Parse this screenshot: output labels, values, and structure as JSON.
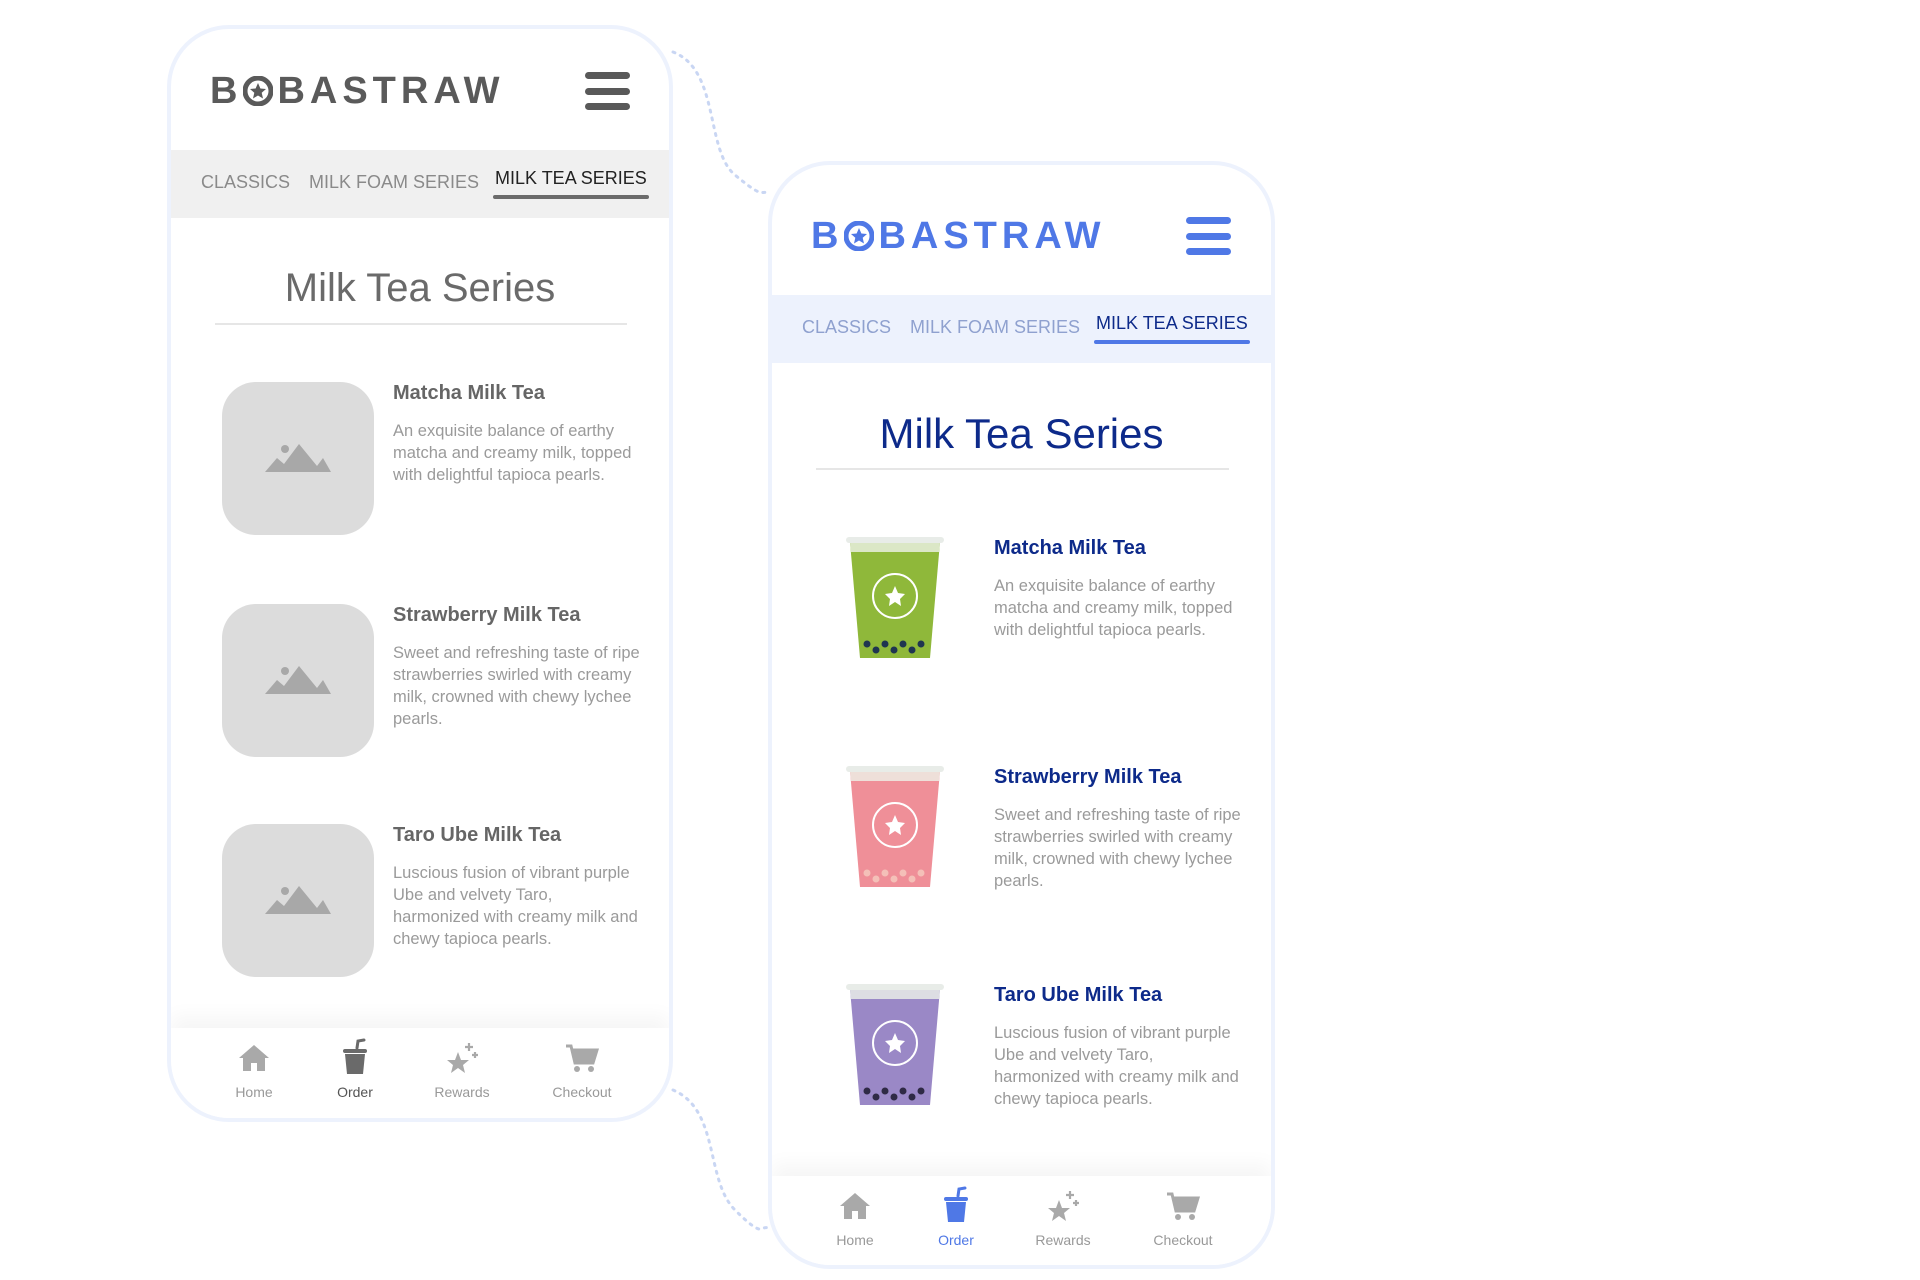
{
  "colors": {
    "accent": "#4f78e6",
    "navy": "#0d2a8a",
    "wire_gray": "#5a5a5a",
    "tabbar_blue": "#edf2fd",
    "tabbar_gray": "#f0f0f0"
  },
  "wireframe": {
    "logo": "BOBASTRAW",
    "tabs": [
      {
        "label": "CLASSICS"
      },
      {
        "label": "MILK FOAM SERIES"
      },
      {
        "label": "MILK TEA SERIES",
        "active": true
      }
    ],
    "title": "Milk Tea Series",
    "items": [
      {
        "name": "Matcha Milk Tea",
        "desc": "An exquisite balance of earthy matcha and creamy milk, topped with delightful tapioca pearls.",
        "icon": "image-placeholder-icon"
      },
      {
        "name": "Strawberry Milk Tea",
        "desc": "Sweet and refreshing taste of ripe strawberries swirled with creamy milk, crowned with chewy lychee pearls.",
        "icon": "image-placeholder-icon"
      },
      {
        "name": "Taro Ube Milk Tea",
        "desc": "Luscious fusion of vibrant purple Ube and velvety Taro, harmonized with creamy milk and chewy tapioca pearls.",
        "icon": "image-placeholder-icon"
      }
    ],
    "nav": [
      {
        "label": "Home",
        "icon": "home-icon"
      },
      {
        "label": "Order",
        "icon": "cup-icon",
        "active": true
      },
      {
        "label": "Rewards",
        "icon": "stars-icon"
      },
      {
        "label": "Checkout",
        "icon": "cart-icon"
      }
    ]
  },
  "final": {
    "logo": "BOBASTRAW",
    "tabs": [
      {
        "label": "CLASSICS"
      },
      {
        "label": "MILK FOAM SERIES"
      },
      {
        "label": "MILK TEA SERIES",
        "active": true
      }
    ],
    "title": "Milk Tea Series",
    "items": [
      {
        "name": "Matcha Milk Tea",
        "desc": "An exquisite balance of earthy matcha and creamy milk, topped with delightful tapioca pearls.",
        "drink_color": "#8fb83a",
        "pearl_color": "#1f3550"
      },
      {
        "name": "Strawberry Milk Tea",
        "desc": "Sweet and refreshing taste of ripe strawberries swirled with creamy milk, crowned with chewy lychee pearls.",
        "drink_color": "#ef8f98",
        "pearl_color": "#f4c0b8"
      },
      {
        "name": "Taro Ube Milk Tea",
        "desc": "Luscious fusion of vibrant purple Ube and velvety Taro, harmonized with creamy milk and chewy tapioca pearls.",
        "drink_color": "#9a88c6",
        "pearl_color": "#2f2a45"
      }
    ],
    "nav": [
      {
        "label": "Home",
        "icon": "home-icon"
      },
      {
        "label": "Order",
        "icon": "cup-icon",
        "active": true
      },
      {
        "label": "Rewards",
        "icon": "stars-icon"
      },
      {
        "label": "Checkout",
        "icon": "cart-icon"
      }
    ]
  }
}
